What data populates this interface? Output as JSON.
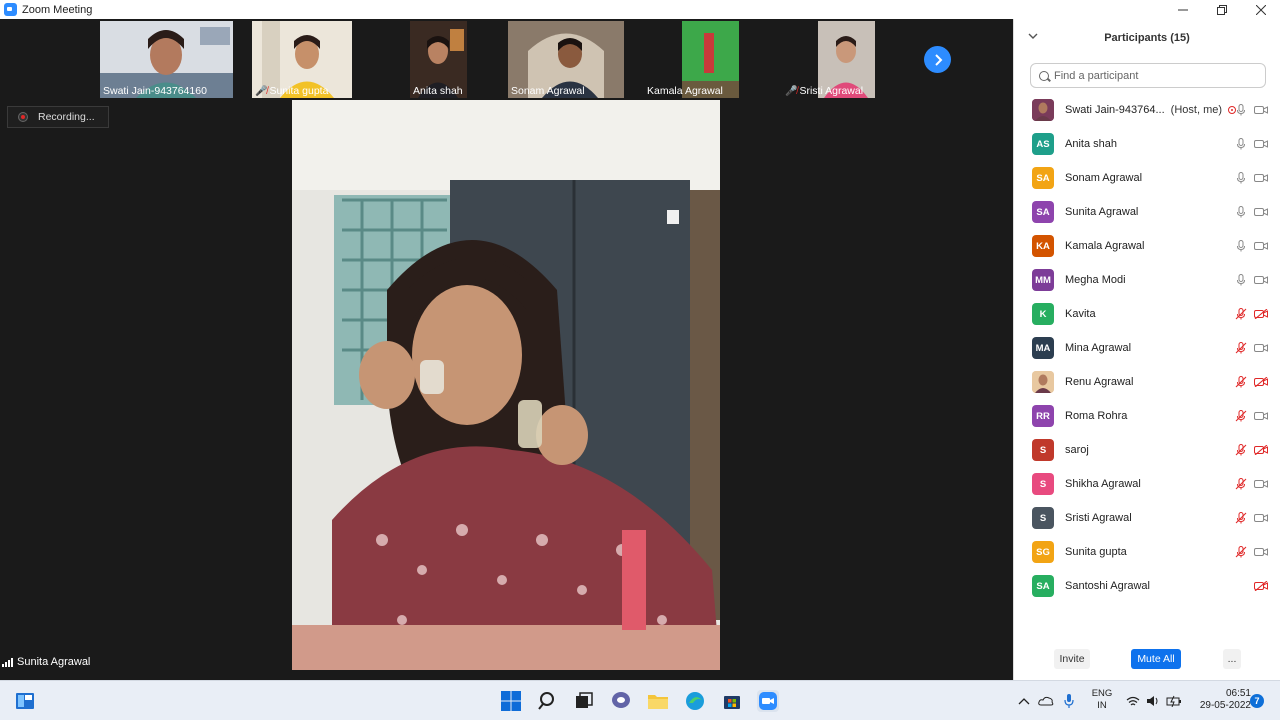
{
  "window": {
    "title": "Zoom Meeting"
  },
  "thumbnails": [
    {
      "name": "Swati Jain-943764160",
      "muted": false
    },
    {
      "name": "Sunita gupta",
      "muted": true
    },
    {
      "name": "Anita shah",
      "muted": false
    },
    {
      "name": "Sonam Agrawal",
      "muted": false
    },
    {
      "name": "Kamala Agrawal",
      "muted": false
    },
    {
      "name": "Sristi Agrawal",
      "muted": true
    }
  ],
  "recording": {
    "label": "Recording..."
  },
  "main_video": {
    "speaker": "Sunita Agrawal"
  },
  "participants_panel": {
    "title": "Participants (15)",
    "search_placeholder": "Find a participant",
    "host_role": "(Host, me)",
    "participants": [
      {
        "name": "Swati Jain-943764...",
        "initials": "",
        "color": "#7a3b5a",
        "photo": true,
        "host": true,
        "mic": "on",
        "video": "on"
      },
      {
        "name": "Anita shah",
        "initials": "AS",
        "color": "#1e9f8a",
        "mic": "on",
        "video": "on"
      },
      {
        "name": "Sonam Agrawal",
        "initials": "SA",
        "color": "#f2a414",
        "mic": "on",
        "video": "on"
      },
      {
        "name": "Sunita Agrawal",
        "initials": "SA",
        "color": "#8e44ad",
        "mic": "on",
        "video": "on"
      },
      {
        "name": "Kamala Agrawal",
        "initials": "KA",
        "color": "#d35400",
        "mic": "on",
        "video": "on"
      },
      {
        "name": "Megha Modi",
        "initials": "MM",
        "color": "#7d3c98",
        "mic": "on",
        "video": "on"
      },
      {
        "name": "Kavita",
        "initials": "K",
        "color": "#27ae60",
        "mic": "muted",
        "video": "off"
      },
      {
        "name": "Mina Agrawal",
        "initials": "MA",
        "color": "#2c3e50",
        "mic": "muted",
        "video": "on"
      },
      {
        "name": "Renu Agrawal",
        "initials": "",
        "color": "#e8c8a0",
        "photo": true,
        "mic": "muted",
        "video": "off"
      },
      {
        "name": "Roma Rohra",
        "initials": "RR",
        "color": "#8e44ad",
        "mic": "muted",
        "video": "on"
      },
      {
        "name": "saroj",
        "initials": "S",
        "color": "#c0392b",
        "mic": "muted",
        "video": "off"
      },
      {
        "name": "Shikha Agrawal",
        "initials": "S",
        "color": "#e84a7f",
        "mic": "muted",
        "video": "on"
      },
      {
        "name": "Sristi Agrawal",
        "initials": "S",
        "color": "#4a5560",
        "mic": "muted",
        "video": "on"
      },
      {
        "name": "Sunita gupta",
        "initials": "SG",
        "color": "#f2a414",
        "mic": "muted",
        "video": "on"
      },
      {
        "name": "Santoshi Agrawal",
        "initials": "SA",
        "color": "#27ae60",
        "mic": "none",
        "video": "off"
      }
    ],
    "footer": {
      "invite": "Invite",
      "mute_all": "Mute All",
      "more": "..."
    }
  },
  "taskbar": {
    "language_line1": "ENG",
    "language_line2": "IN",
    "time": "06:51",
    "date": "29-05-2022",
    "notification_count": "7"
  }
}
